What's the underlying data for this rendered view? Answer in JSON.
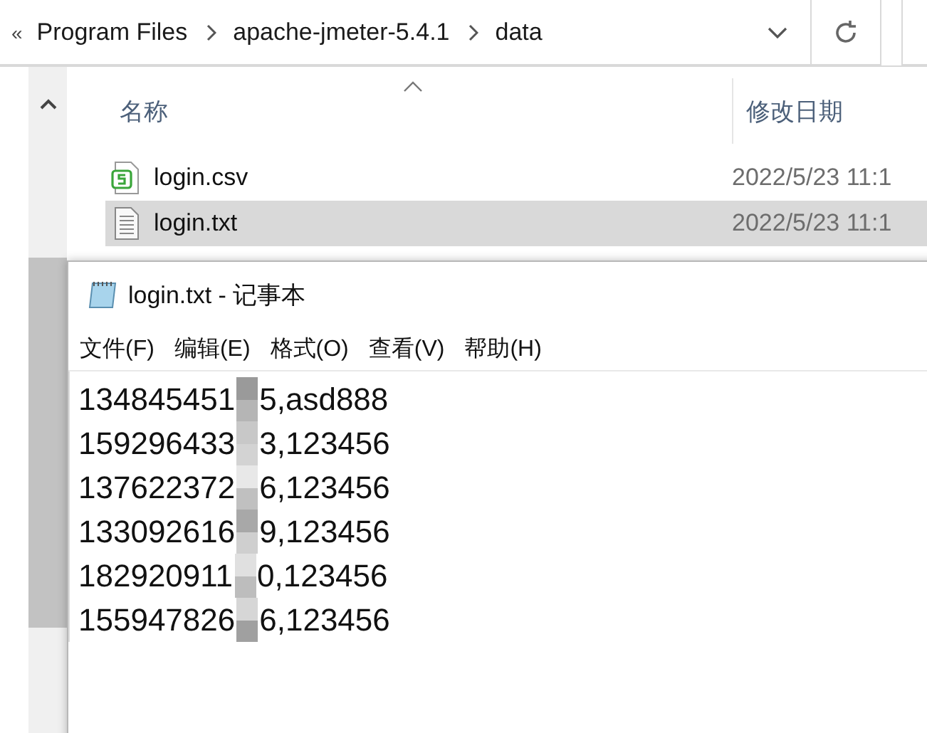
{
  "address_bar": {
    "overflow": "«",
    "crumbs": [
      "Program Files",
      "apache-jmeter-5.4.1",
      "data"
    ]
  },
  "file_list": {
    "columns": [
      "名称",
      "修改日期"
    ],
    "rows": [
      {
        "name": "login.csv",
        "kind": "csv",
        "modified": "2022/5/23 11:1",
        "selected": false
      },
      {
        "name": "login.txt",
        "kind": "txt",
        "modified": "2022/5/23 11:1",
        "selected": true
      }
    ]
  },
  "notepad": {
    "title": "login.txt - 记事本",
    "menu": [
      "文件(F)",
      "编辑(E)",
      "格式(O)",
      "查看(V)",
      "帮助(H)"
    ],
    "lines": [
      {
        "before": "134845451",
        "after": "5,asd888"
      },
      {
        "before": "159296433",
        "after": "3,123456"
      },
      {
        "before": "137622372",
        "after": "6,123456"
      },
      {
        "before": "133092616",
        "after": "9,123456"
      },
      {
        "before": "182920911",
        "after": "0,123456"
      },
      {
        "before": "155947826",
        "after": "6,123456"
      }
    ]
  }
}
